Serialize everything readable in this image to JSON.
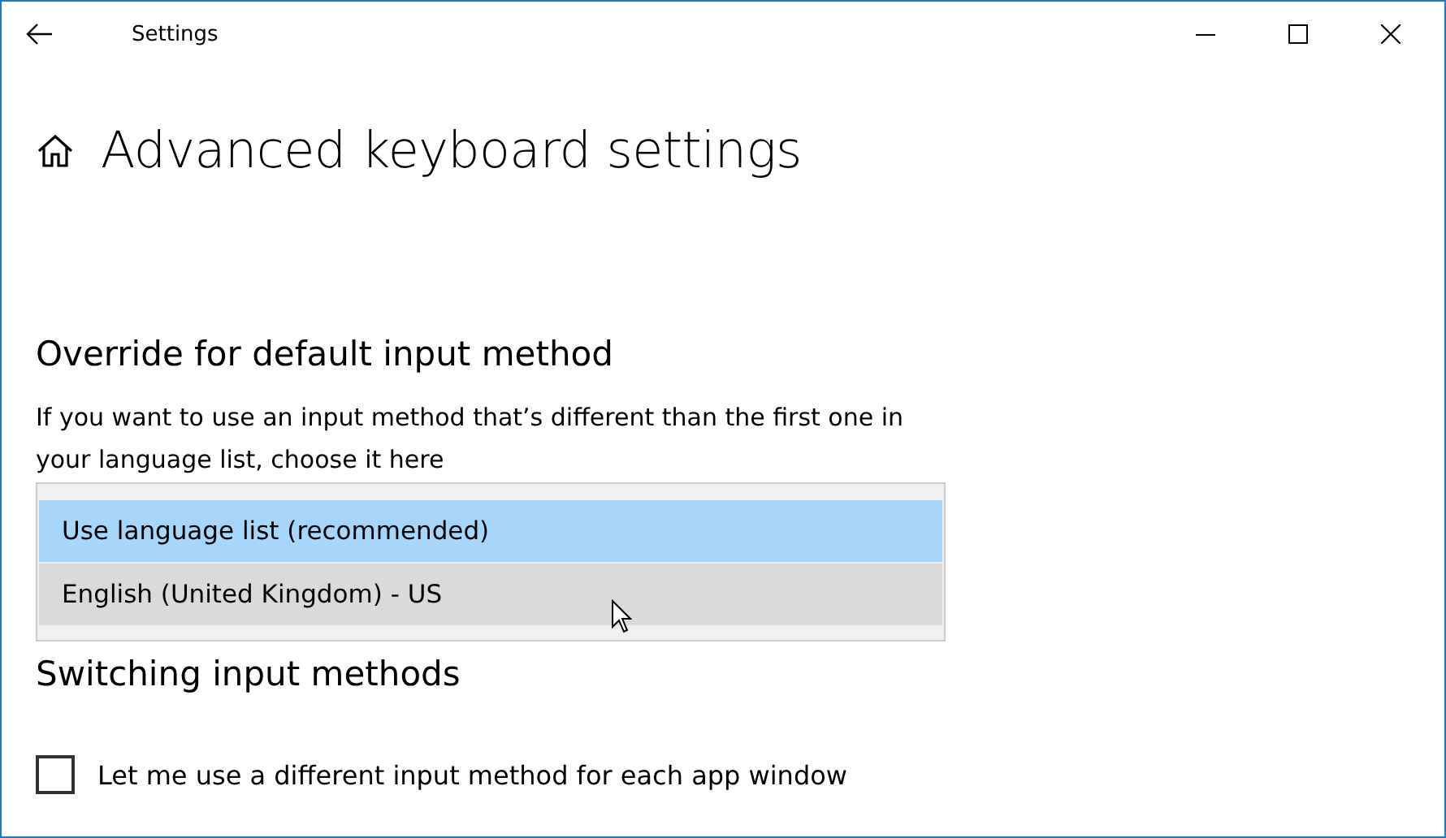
{
  "window": {
    "title": "Settings"
  },
  "page_title": "Advanced keyboard settings",
  "override": {
    "heading": "Override for default input method",
    "description": "If you want to use an input method that’s different than the first one in your language list, choose it here",
    "options": [
      {
        "label": "Use language list (recommended)",
        "selected": true,
        "hovered": false
      },
      {
        "label": "English (United Kingdom) - US",
        "selected": false,
        "hovered": true
      }
    ]
  },
  "switching": {
    "heading": "Switching input methods",
    "checkbox": {
      "label": "Let me use a different input method for each app window",
      "checked": false
    }
  }
}
